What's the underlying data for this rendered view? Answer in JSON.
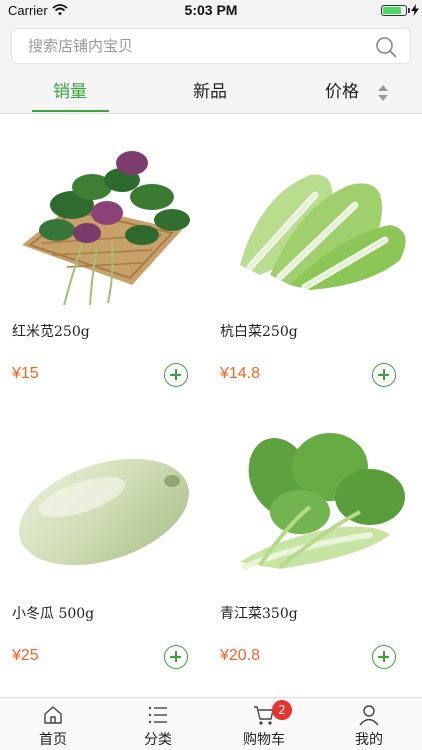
{
  "status_bar": {
    "carrier": "Carrier",
    "time": "5:03 PM"
  },
  "search": {
    "placeholder": "搜索店铺内宝贝",
    "value": ""
  },
  "tabs": [
    {
      "label": "销量",
      "active": true
    },
    {
      "label": "新品",
      "active": false
    },
    {
      "label": "价格",
      "active": false
    }
  ],
  "products": [
    {
      "name": "红米苋250g",
      "price": "¥15",
      "image": "red-amaranth"
    },
    {
      "name": "杭白菜250g",
      "price": "¥14.8",
      "image": "hang-bok-choy"
    },
    {
      "name": "小冬瓜 500g",
      "price": "¥25",
      "image": "small-wax-gourd"
    },
    {
      "name": "青江菜350g",
      "price": "¥20.8",
      "image": "qingjiang-bok-choy"
    }
  ],
  "bottom_nav": [
    {
      "label": "首页",
      "icon": "home-icon"
    },
    {
      "label": "分类",
      "icon": "list-icon"
    },
    {
      "label": "购物车",
      "icon": "cart-icon",
      "badge": "2"
    },
    {
      "label": "我的",
      "icon": "user-icon"
    }
  ],
  "colors": {
    "accent": "#3aa63a",
    "price": "#f26522",
    "badge": "#e8322f"
  }
}
